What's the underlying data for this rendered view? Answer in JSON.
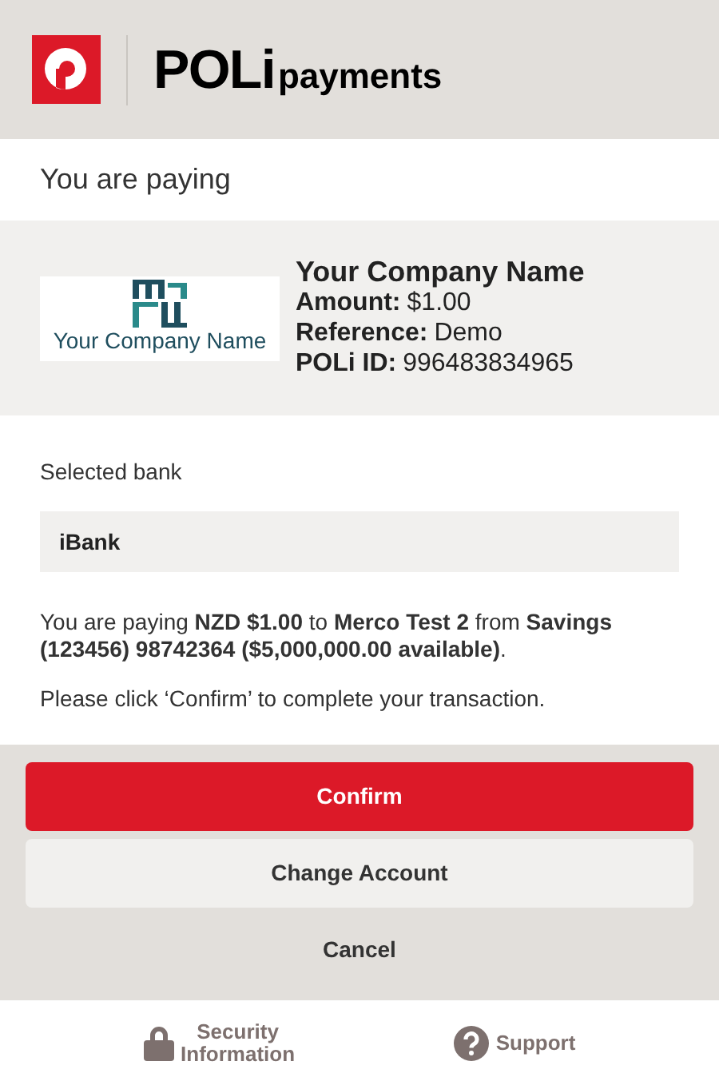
{
  "header": {
    "brand_main": "POLi",
    "brand_sub": "payments"
  },
  "section_title": "You are paying",
  "merchant": {
    "logo_text": "Your Company Name",
    "name": "Your Company Name",
    "details": [
      {
        "label": "Amount:",
        "value": "$1.00"
      },
      {
        "label": "Reference:",
        "value": "Demo"
      },
      {
        "label": "POLi ID:",
        "value": "996483834965"
      }
    ]
  },
  "bank": {
    "label": "Selected bank",
    "value": "iBank"
  },
  "summary": "You are paying **NZD $1.00** to **Merco Test 2** from **Savings (123456) 98742364 ($5,000,000.00 available)**.",
  "instruction": "Please click ‘Confirm’ to complete your transaction.",
  "buttons": [
    {
      "label": "Confirm",
      "kind": "primary"
    },
    {
      "label": "Change Account",
      "kind": "secondary"
    },
    {
      "label": "Cancel",
      "kind": "plain"
    }
  ],
  "footer": [
    {
      "label": "Security Information",
      "kind": "security"
    },
    {
      "label": "Support",
      "kind": "support"
    }
  ]
}
